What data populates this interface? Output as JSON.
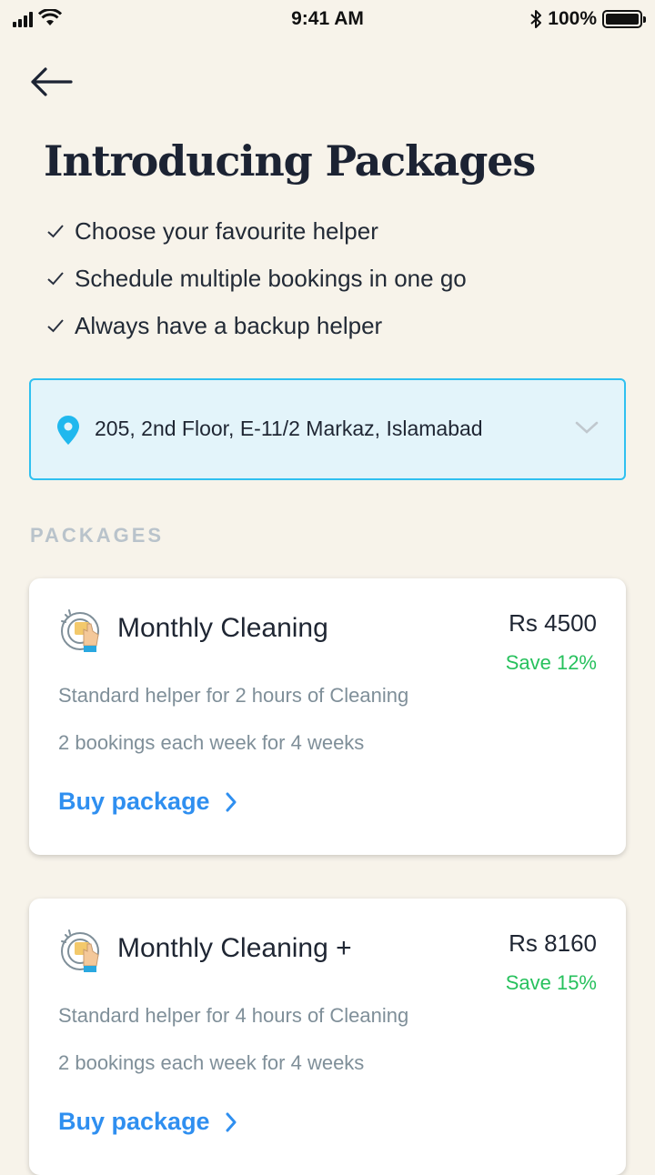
{
  "status_bar": {
    "time": "9:41 AM",
    "battery_text": "100%",
    "battery_level": 1.0,
    "icons": [
      "signal-icon",
      "wifi-icon",
      "bluetooth-icon",
      "battery-icon"
    ]
  },
  "header": {
    "back_icon": "arrow-left-icon",
    "title": "Introducing Packages"
  },
  "benefits": [
    "Choose your favourite helper",
    "Schedule multiple bookings in one go",
    "Always have a backup helper"
  ],
  "address": {
    "text": "205, 2nd Floor, E-11/2 Markaz, Islamabad",
    "icon": "location-pin-icon",
    "dropdown_icon": "chevron-down-icon"
  },
  "packages_section": {
    "label": "PACKAGES",
    "items": [
      {
        "name": "Monthly Cleaning",
        "price": "Rs 4500",
        "savings": "Save 12%",
        "description": "Standard helper for 2 hours of Cleaning",
        "schedule": "2 bookings each week for 4 weeks",
        "cta": "Buy package",
        "icon": "cleaning-hand-icon"
      },
      {
        "name": "Monthly Cleaning +",
        "price": "Rs 8160",
        "savings": "Save 15%",
        "description": "Standard helper for 4 hours of Cleaning",
        "schedule": "2 bookings each week for 4 weeks",
        "cta": "Buy package",
        "icon": "cleaning-hand-icon"
      }
    ]
  },
  "colors": {
    "background": "#f7f3ea",
    "accent_blue": "#2f8ff0",
    "address_border": "#2fc0f0",
    "address_bg": "#e3f4fa",
    "savings_green": "#27c15d",
    "muted_text": "#7f8f99"
  }
}
